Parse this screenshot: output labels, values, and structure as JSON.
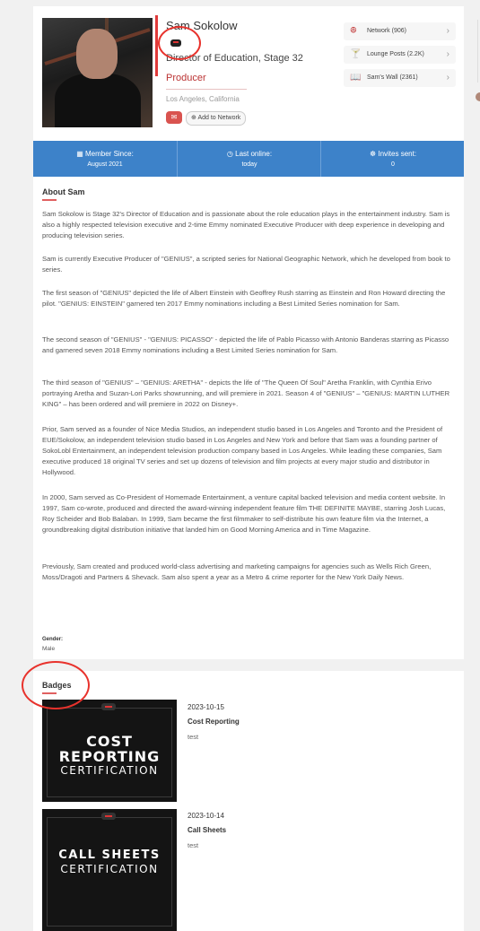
{
  "profile": {
    "name": "Sam Sokolow",
    "title": "Director of Education, Stage 32",
    "role": "Producer",
    "location": "Los Angeles, California",
    "add_to_network": "Add to Network"
  },
  "side_links": [
    {
      "label": "Network (906)",
      "icon": "network-icon"
    },
    {
      "label": "Lounge Posts (2.2K)",
      "icon": "lounge-icon"
    },
    {
      "label": "Sam's Wall (2361)",
      "icon": "book-icon"
    }
  ],
  "stats": [
    {
      "label": "Member Since:",
      "value": "August 2021"
    },
    {
      "label": "Last online:",
      "value": "today"
    },
    {
      "label": "Invites sent:",
      "value": "0"
    }
  ],
  "about": {
    "heading": "About Sam",
    "paragraphs": [
      "Sam Sokolow is Stage 32's Director of Education and is passionate about the role education plays in the entertainment industry. Sam is also a highly respected television executive and 2-time Emmy nominated Executive Producer with deep experience in developing and producing television series.",
      "Sam is currently Executive Producer of \"GENIUS\", a scripted series for National Geographic Network, which he developed from book to series.",
      "The first season of \"GENIUS\" depicted the life of Albert Einstein with Geoffrey Rush starring as Einstein and Ron Howard directing the pilot. \"GENIUS: EINSTEIN\" garnered ten 2017 Emmy nominations including a Best Limited Series nomination for Sam.",
      "The second season of \"GENIUS\" - \"GENIUS: PICASSO\" - depicted the life of Pablo Picasso with Antonio Banderas starring as Picasso and garnered seven 2018 Emmy nominations including a Best Limited Series nomination for Sam.",
      "The third season of \"GENIUS\" – \"GENIUS: ARETHA\" - depicts the life of \"The Queen Of Soul\" Aretha Franklin, with Cynthia Erivo portraying Aretha and Suzan-Lori Parks showrunning, and will premiere in 2021. Season 4 of \"GENIUS\" – \"GENIUS: MARTIN LUTHER KING\" – has been ordered and will premiere in 2022 on Disney+.",
      "Prior, Sam served as a founder of Nice Media Studios, an independent studio based in Los Angeles and Toronto and the President of EUE/Sokolow, an independent television studio based in Los Angeles and New York and before that Sam was a founding partner of SokoLobl Entertainment, an independent television production company based in Los Angeles. While leading these companies, Sam executive produced 18 original TV series and set up dozens of television and film projects at every major studio and distributor in Hollywood.",
      "In 2000, Sam served as Co-President of Homemade Entertainment, a venture capital backed television and media content website. In 1997, Sam co-wrote, produced and directed the award-winning independent feature film THE DEFINITE MAYBE, starring Josh Lucas, Roy Scheider and Bob Balaban. In 1999, Sam became the first filmmaker to self-distribute his own feature film via the Internet, a groundbreaking digital distribution initiative that landed him on Good Morning America and in Time Magazine.",
      "Previously, Sam created and produced world-class advertising and marketing campaigns for agencies such as Wells Rich Green, Moss/Dragoti and Partners & Shevack. Sam also spent a year as a Metro & crime reporter for the New York Daily News."
    ]
  },
  "gender": {
    "label": "Gender:",
    "value": "Male"
  },
  "badges": {
    "heading": "Badges",
    "items": [
      {
        "date": "2023-10-15",
        "name": "Cost Reporting",
        "desc": "test",
        "img_line1": "COST",
        "img_line2": "REPORTING",
        "img_line3": "CERTIFICATION"
      },
      {
        "date": "2023-10-14",
        "name": "Call Sheets",
        "desc": "test",
        "img_line1": "CALL SHEETS",
        "img_line2": "CERTIFICATION"
      }
    ]
  },
  "colors": {
    "accent": "#3d82c9",
    "brand_red": "#c23a3a",
    "annotation": "#e8322c"
  }
}
